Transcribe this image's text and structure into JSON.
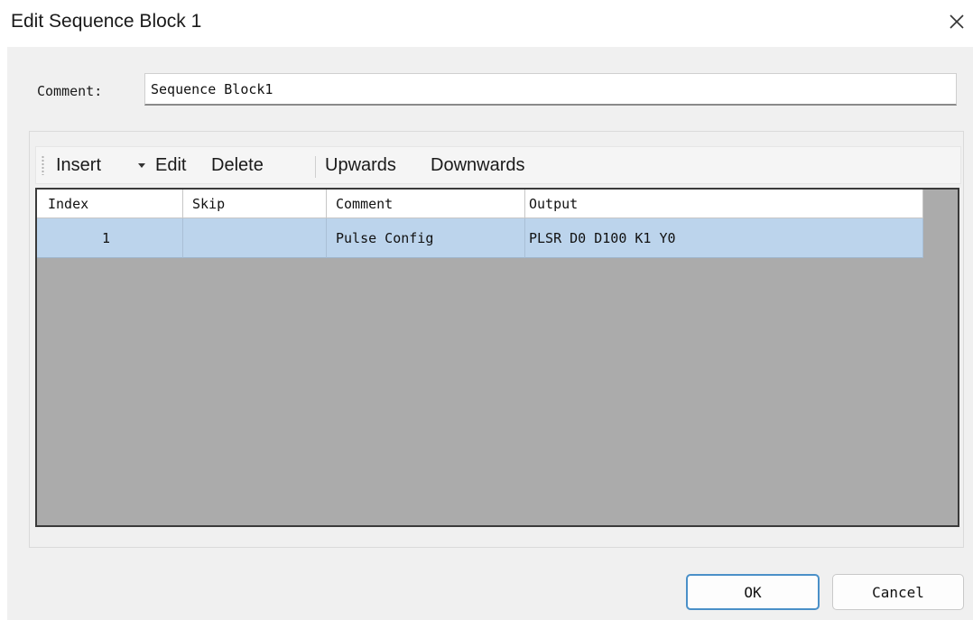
{
  "window": {
    "title": "Edit Sequence Block 1"
  },
  "comment": {
    "label": "Comment:",
    "value": "Sequence Block1"
  },
  "toolbar": {
    "insert_label": "Insert",
    "edit_label": "Edit",
    "delete_label": "Delete",
    "upwards_label": "Upwards",
    "downwards_label": "Downwards"
  },
  "table": {
    "columns": [
      "Index",
      "Skip",
      "Comment",
      "Output"
    ],
    "rows": [
      {
        "index": "1",
        "skip": "",
        "comment": "Pulse Config",
        "output": "PLSR D0 D100 K1 Y0"
      }
    ],
    "selected_row_color": "#bcd4ec",
    "empty_area_color": "#ababab"
  },
  "buttons": {
    "ok_label": "OK",
    "cancel_label": "Cancel"
  },
  "icons": {
    "close": "close-icon",
    "insert_dropdown": "chevron-down-icon",
    "toolbar_grip": "grip-icon"
  }
}
